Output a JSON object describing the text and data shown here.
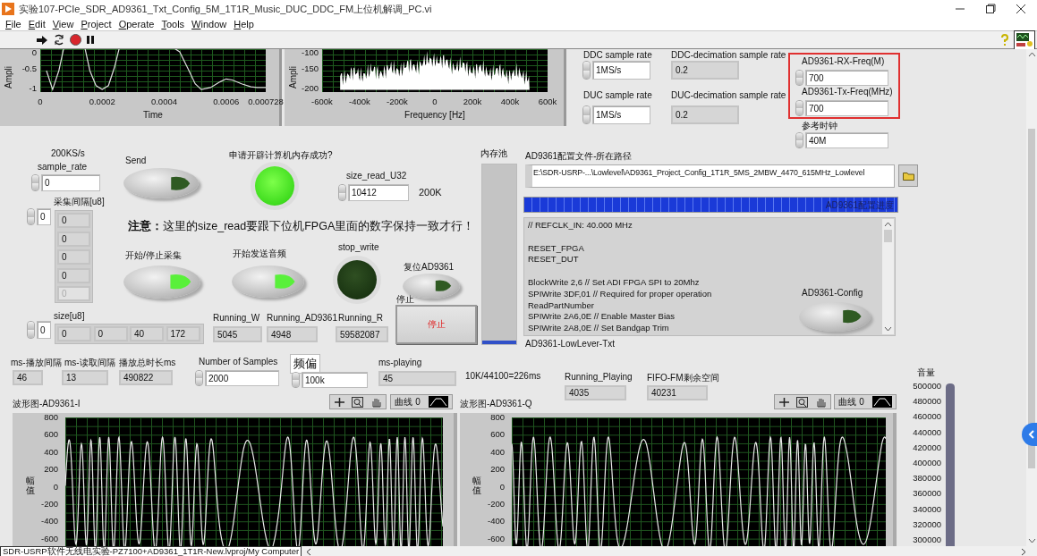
{
  "window": {
    "title": "实验107-PCIe_SDR_AD9361_Txt_Config_5M_1T1R_Music_DUC_DDC_FM上位机解调_PC.vi"
  },
  "menu": [
    {
      "label": "File"
    },
    {
      "label": "Edit"
    },
    {
      "label": "View"
    },
    {
      "label": "Project"
    },
    {
      "label": "Operate"
    },
    {
      "label": "Tools"
    },
    {
      "label": "Window"
    },
    {
      "label": "Help"
    }
  ],
  "top_graphs": [
    {
      "chart_data": {
        "type": "line",
        "xlabel": "Time",
        "ylabel": "Ampli",
        "x": [
          2e-05,
          4e-05,
          6e-05,
          8e-05,
          0.0001,
          0.00012,
          0.00014,
          0.00016,
          0.00018,
          0.0002,
          0.00022,
          0.00024,
          0.00026,
          0.00028,
          0.0003,
          0.00035,
          0.0004,
          0.00045,
          0.00048,
          0.0005,
          0.00052,
          0.00055,
          0.00058,
          0.0006,
          0.00062,
          0.00065,
          0.00068,
          0.0007,
          0.000728
        ],
        "series": [
          {
            "values": [
              -0.5,
              -1,
              -0.5,
              null,
              null,
              null,
              null,
              -0.5,
              -0.9,
              -1,
              -0.9,
              -0.4,
              null,
              null,
              null,
              null,
              null,
              0,
              -0.5,
              -0.85,
              -1,
              -0.95,
              -0.8,
              -0.72,
              -0.75,
              -0.85,
              -0.93,
              -0.95,
              -0.95
            ]
          }
        ],
        "xlim": [
          0,
          0.000728
        ],
        "ylim": [
          -1.07,
          0.07
        ],
        "xticks": [
          0,
          0.0002,
          0.0004,
          0.0006,
          0.000728
        ],
        "yticks": [
          0,
          -0.5,
          -1
        ]
      }
    },
    {
      "ylabel": "Ampli",
      "yticks": [
        "-100",
        "-150",
        "-200"
      ],
      "xticks": [
        "-600k",
        "-400k",
        "-200k",
        "0",
        "200k",
        "400k",
        "600k"
      ],
      "xlabel": "Frequency [Hz]"
    }
  ],
  "rates": [
    {
      "label": "DDC sample rate",
      "value": "1MS/s",
      "kind": "control"
    },
    {
      "label": "DDC-decimation sample rate",
      "value": "0.2",
      "kind": "indicator"
    },
    {
      "label": "DUC sample rate",
      "value": "1MS/s",
      "kind": "control"
    },
    {
      "label": "DUC-decimation sample rate",
      "value": "0.2",
      "kind": "indicator"
    }
  ],
  "frequencies": [
    {
      "label": "AD9361-RX-Freq(M)",
      "value": "700",
      "kind": "control"
    },
    {
      "label": "AD9361-Tx-Freq(MHz)",
      "value": "700",
      "kind": "control"
    }
  ],
  "ref_clock": {
    "label": "参考时钟",
    "value": "40M",
    "kind": "control"
  },
  "sample_rate": {
    "note": "200KS/s",
    "label": "sample_rate",
    "value": "0",
    "kind": "control"
  },
  "interval_array": {
    "label": "采集间隔[u8]",
    "index": "0",
    "items": [
      {
        "value": "0",
        "disabled": false
      },
      {
        "value": "0",
        "disabled": false
      },
      {
        "value": "0",
        "disabled": false
      },
      {
        "value": "0",
        "disabled": false
      },
      {
        "value": "0",
        "disabled": true
      }
    ]
  },
  "size_array": {
    "label": "size[u8]",
    "index": "0",
    "items": [
      {
        "value": "0",
        "disabled": false
      },
      {
        "value": "0",
        "disabled": false
      },
      {
        "value": "40",
        "disabled": false
      },
      {
        "value": "172",
        "disabled": false
      }
    ]
  },
  "buttons": [
    {
      "label": "Send",
      "on": false
    },
    {
      "label": "开始/停止采集",
      "on": true
    },
    {
      "label": "开始发送音频",
      "on": true
    },
    {
      "label": "复位AD9361",
      "on": false
    },
    {
      "label": "AD9361-Config",
      "on": false
    }
  ],
  "leds": [
    {
      "label": "申请开辟计算机内存成功?",
      "on": true
    },
    {
      "label": "stop_write",
      "on": false
    }
  ],
  "size_read": {
    "label": "size_read_U32",
    "value": "10412",
    "kind": "control",
    "unit": "200K"
  },
  "notice": "**注意：**这里的size_read要跟下位机FPGA里面的数字保持一致才行！",
  "running": [
    {
      "label": "Running_W",
      "value": "5045",
      "kind": "indicator"
    },
    {
      "label": "Running_AD9361",
      "value": "4948",
      "kind": "indicator"
    },
    {
      "label": "Running_R",
      "value": "59582087",
      "kind": "indicator"
    }
  ],
  "stop": {
    "caption": "停止",
    "label": "停止"
  },
  "memory_pool": {
    "label": "内存池",
    "level": 0.01
  },
  "config_file": {
    "label": "AD9361配置文件-所在路径",
    "path": "E:\\SDR-USRP-...\\Lowlevel\\AD9361_Project_Config_1T1R_5MS_2MBW_4470_615MHz_Lowlevel"
  },
  "progress": {
    "label": "AD9361配置进度",
    "level": 1
  },
  "config_text": {
    "label": "AD9361-LowLever-Txt",
    "text": "// REFCLK_IN: 40.000 MHz\n\nRESET_FPGA\nRESET_DUT\n\nBlockWrite 2,6 // Set ADI FPGA SPI to 20Mhz\nSPIWrite 3DF,01 // Required for proper operation\nReadPartNumber\nSPIWrite 2A6,0E // Enable Master Bias\nSPIWrite 2A8,0E // Set Bandgap Trim"
  },
  "stats": [
    {
      "label": "ms-播放间隔",
      "value": "46",
      "kind": "indicator"
    },
    {
      "label": "ms-读取间隔",
      "value": "13",
      "kind": "indicator"
    },
    {
      "label": "播放总时长ms",
      "value": "490822",
      "kind": "indicator"
    },
    {
      "label": "Number of Samples",
      "value": "2000",
      "kind": "control"
    },
    {
      "label": "频偏",
      "value": "100k",
      "kind": "control"
    },
    {
      "label": "ms-playing",
      "value": "45",
      "kind": "indicator"
    },
    {
      "label": "Running_Playing",
      "value": "4035",
      "kind": "indicator"
    },
    {
      "label": "FIFO-FM剩余空间",
      "value": "40231",
      "kind": "indicator"
    }
  ],
  "formula": "10K/44100=226ms",
  "waveforms": [
    {
      "title": "波形图-AD9361-I",
      "ylabel": "幅值",
      "yticks": [
        "800",
        "600",
        "400",
        "200",
        "0",
        "-200",
        "-400",
        "-600"
      ],
      "legend": "曲线 0"
    },
    {
      "title": "波形图-AD9361-Q",
      "ylabel": "幅值",
      "yticks": [
        "800",
        "600",
        "400",
        "200",
        "0",
        "-200",
        "-400",
        "-600"
      ],
      "legend": "曲线 0"
    }
  ],
  "volume": {
    "label": "音量",
    "ticks": [
      "500000",
      "480000",
      "460000",
      "440000",
      "420000",
      "400000",
      "380000",
      "360000",
      "340000",
      "320000",
      "300000"
    ],
    "level": 1
  },
  "status_bar": {
    "path": "SDR-USRP软件无线电实验-PZ7100+AD9361_1T1R-New.lvproj/My Computer"
  }
}
